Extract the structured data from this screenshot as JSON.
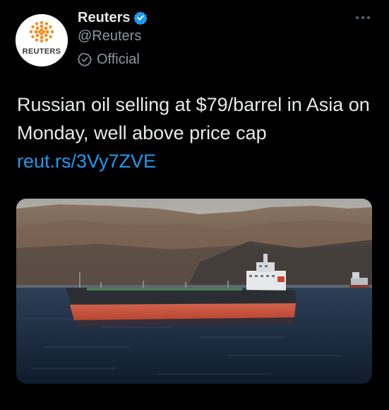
{
  "tweet": {
    "author": {
      "display_name": "Reuters",
      "handle": "@Reuters",
      "avatar_wordmark": "REUTERS",
      "verified_icon": "verified-badge-icon",
      "official_label": "Official",
      "official_icon": "official-check-icon"
    },
    "more_icon": "more-options-icon",
    "text": "Russian oil selling at $79/barrel in Asia on Monday, well above price cap ",
    "link": "reut.rs/3Vy7ZVE",
    "media": {
      "kind": "photo",
      "subject": "oil tanker ship on water"
    },
    "colors": {
      "background": "#000000",
      "primary_text": "#e7e9ea",
      "secondary_text": "#8b98a5",
      "link": "#1d9bf0",
      "verified": "#1d9bf0",
      "brand_orange": "#f28c1c"
    }
  }
}
